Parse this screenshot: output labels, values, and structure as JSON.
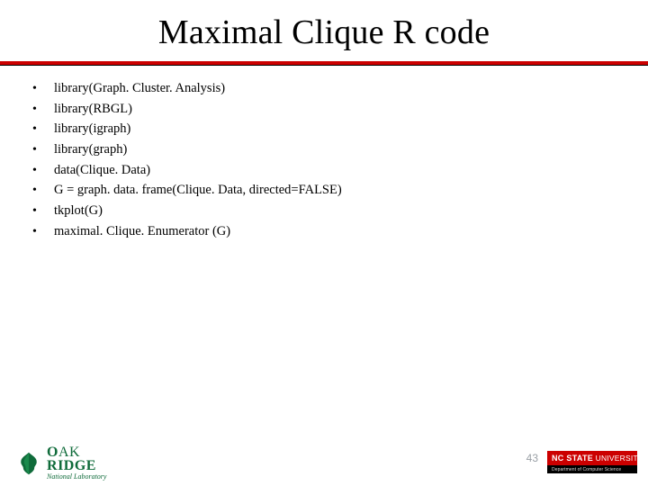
{
  "title": "Maximal Clique R code",
  "bullets": [
    "library(Graph. Cluster. Analysis)",
    "library(RBGL)",
    "library(igraph)",
    "library(graph)",
    "data(Clique. Data)",
    "G = graph. data. frame(Clique. Data, directed=FALSE)",
    "tkplot(G)",
    "maximal. Clique. Enumerator (G)"
  ],
  "page_number": "43",
  "oakridge": {
    "line1a": "O",
    "line1b": "AK",
    "line2a": "R",
    "line2b": "IDGE",
    "sub": "National Laboratory"
  },
  "ncstate": {
    "main": "NC STATE",
    "uni": " UNIVERSITY",
    "sub": "Department of Computer Science"
  }
}
